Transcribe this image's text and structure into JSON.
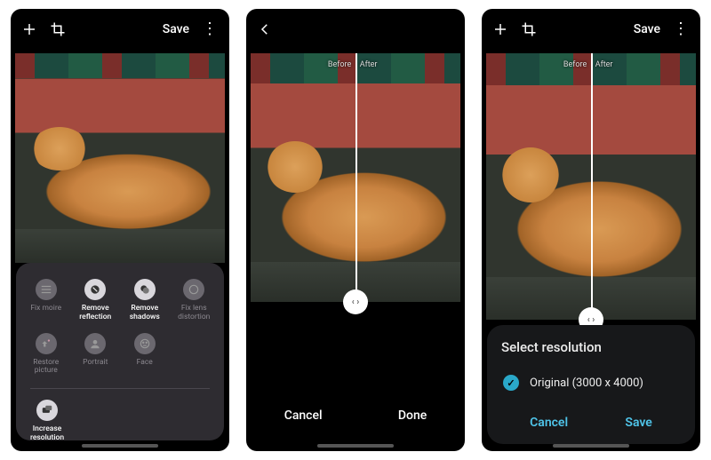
{
  "screen1": {
    "topbar": {
      "save": "Save"
    },
    "tools": [
      {
        "id": "fix-moire",
        "label": "Fix moire",
        "active": false
      },
      {
        "id": "remove-reflection",
        "label": "Remove reflection",
        "active": true
      },
      {
        "id": "remove-shadows",
        "label": "Remove shadows",
        "active": true
      },
      {
        "id": "fix-lens-distortion",
        "label": "Fix lens distortion",
        "active": false
      },
      {
        "id": "restore-picture",
        "label": "Restore picture",
        "active": false
      },
      {
        "id": "portrait",
        "label": "Portrait",
        "active": false
      },
      {
        "id": "face",
        "label": "Face",
        "active": false
      }
    ],
    "featured": {
      "id": "increase-resolution",
      "label": "Increase resolution",
      "active": true
    }
  },
  "screen2": {
    "compare": {
      "before": "Before",
      "after": "After"
    },
    "buttons": {
      "cancel": "Cancel",
      "done": "Done"
    }
  },
  "screen3": {
    "topbar": {
      "save": "Save"
    },
    "compare": {
      "before": "Before",
      "after": "After"
    },
    "sheet": {
      "title": "Select resolution",
      "option": "Original (3000 x 4000)",
      "cancel": "Cancel",
      "save": "Save"
    }
  }
}
